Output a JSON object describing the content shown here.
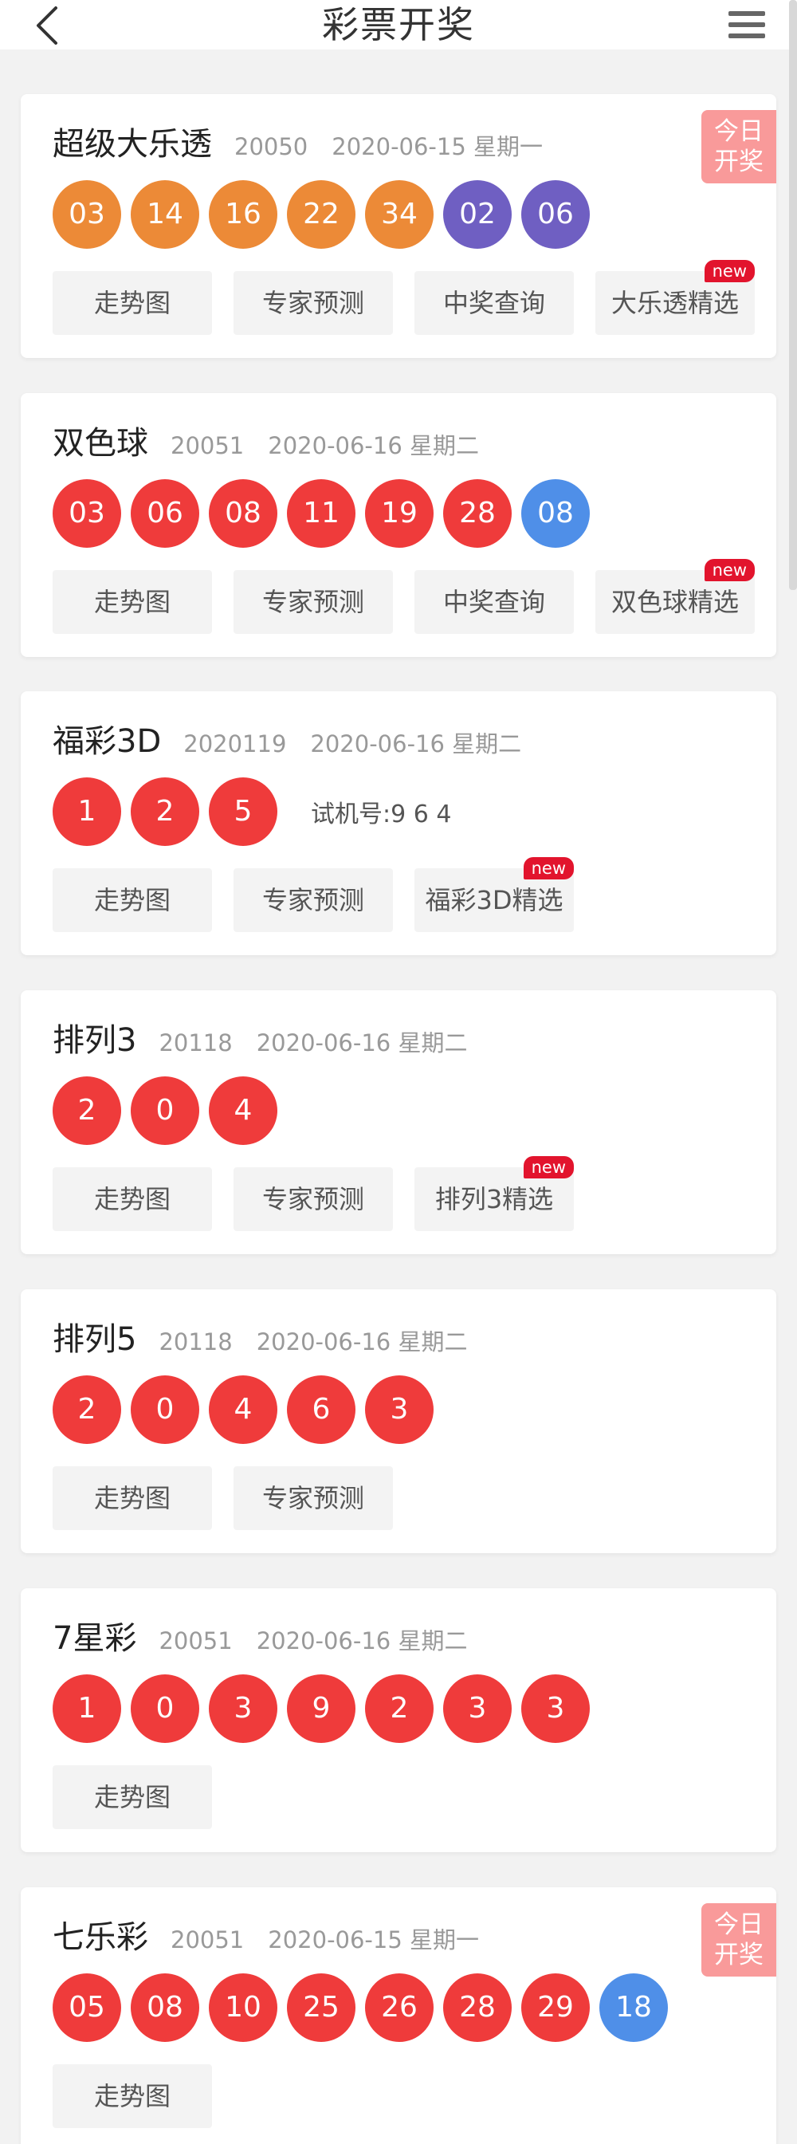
{
  "header": {
    "title": "彩票开奖"
  },
  "new_label": "new",
  "cards": [
    {
      "name": "超级大乐透",
      "issue": "20050",
      "date": "2020-06-15 星期一",
      "badge": [
        "今日",
        "开奖"
      ],
      "balls": [
        {
          "n": "03",
          "c": "orange"
        },
        {
          "n": "14",
          "c": "orange"
        },
        {
          "n": "16",
          "c": "orange"
        },
        {
          "n": "22",
          "c": "orange"
        },
        {
          "n": "34",
          "c": "orange"
        },
        {
          "n": "02",
          "c": "purple"
        },
        {
          "n": "06",
          "c": "purple"
        }
      ],
      "buttons": [
        {
          "label": "走势图"
        },
        {
          "label": "专家预测"
        },
        {
          "label": "中奖查询"
        },
        {
          "label": "大乐透精选",
          "new": true
        }
      ]
    },
    {
      "name": "双色球",
      "issue": "20051",
      "date": "2020-06-16 星期二",
      "balls": [
        {
          "n": "03",
          "c": "red"
        },
        {
          "n": "06",
          "c": "red"
        },
        {
          "n": "08",
          "c": "red"
        },
        {
          "n": "11",
          "c": "red"
        },
        {
          "n": "19",
          "c": "red"
        },
        {
          "n": "28",
          "c": "red"
        },
        {
          "n": "08",
          "c": "blue"
        }
      ],
      "buttons": [
        {
          "label": "走势图"
        },
        {
          "label": "专家预测"
        },
        {
          "label": "中奖查询"
        },
        {
          "label": "双色球精选",
          "new": true
        }
      ]
    },
    {
      "name": "福彩3D",
      "issue": "2020119",
      "date": "2020-06-16 星期二",
      "trial": "试机号:9 6 4",
      "balls": [
        {
          "n": "1",
          "c": "red"
        },
        {
          "n": "2",
          "c": "red"
        },
        {
          "n": "5",
          "c": "red"
        }
      ],
      "buttons": [
        {
          "label": "走势图"
        },
        {
          "label": "专家预测"
        },
        {
          "label": "福彩3D精选",
          "new": true
        }
      ]
    },
    {
      "name": "排列3",
      "issue": "20118",
      "date": "2020-06-16 星期二",
      "balls": [
        {
          "n": "2",
          "c": "red"
        },
        {
          "n": "0",
          "c": "red"
        },
        {
          "n": "4",
          "c": "red"
        }
      ],
      "buttons": [
        {
          "label": "走势图"
        },
        {
          "label": "专家预测"
        },
        {
          "label": "排列3精选",
          "new": true
        }
      ]
    },
    {
      "name": "排列5",
      "issue": "20118",
      "date": "2020-06-16 星期二",
      "balls": [
        {
          "n": "2",
          "c": "red"
        },
        {
          "n": "0",
          "c": "red"
        },
        {
          "n": "4",
          "c": "red"
        },
        {
          "n": "6",
          "c": "red"
        },
        {
          "n": "3",
          "c": "red"
        }
      ],
      "buttons": [
        {
          "label": "走势图"
        },
        {
          "label": "专家预测"
        }
      ]
    },
    {
      "name": "7星彩",
      "issue": "20051",
      "date": "2020-06-16 星期二",
      "balls": [
        {
          "n": "1",
          "c": "red"
        },
        {
          "n": "0",
          "c": "red"
        },
        {
          "n": "3",
          "c": "red"
        },
        {
          "n": "9",
          "c": "red"
        },
        {
          "n": "2",
          "c": "red"
        },
        {
          "n": "3",
          "c": "red"
        },
        {
          "n": "3",
          "c": "red"
        }
      ],
      "buttons": [
        {
          "label": "走势图"
        }
      ]
    },
    {
      "name": "七乐彩",
      "issue": "20051",
      "date": "2020-06-15 星期一",
      "badge": [
        "今日",
        "开奖"
      ],
      "balls": [
        {
          "n": "05",
          "c": "red"
        },
        {
          "n": "08",
          "c": "red"
        },
        {
          "n": "10",
          "c": "red"
        },
        {
          "n": "25",
          "c": "red"
        },
        {
          "n": "26",
          "c": "red"
        },
        {
          "n": "28",
          "c": "red"
        },
        {
          "n": "29",
          "c": "red"
        },
        {
          "n": "18",
          "c": "blue"
        }
      ],
      "buttons": [
        {
          "label": "走势图"
        }
      ]
    }
  ]
}
